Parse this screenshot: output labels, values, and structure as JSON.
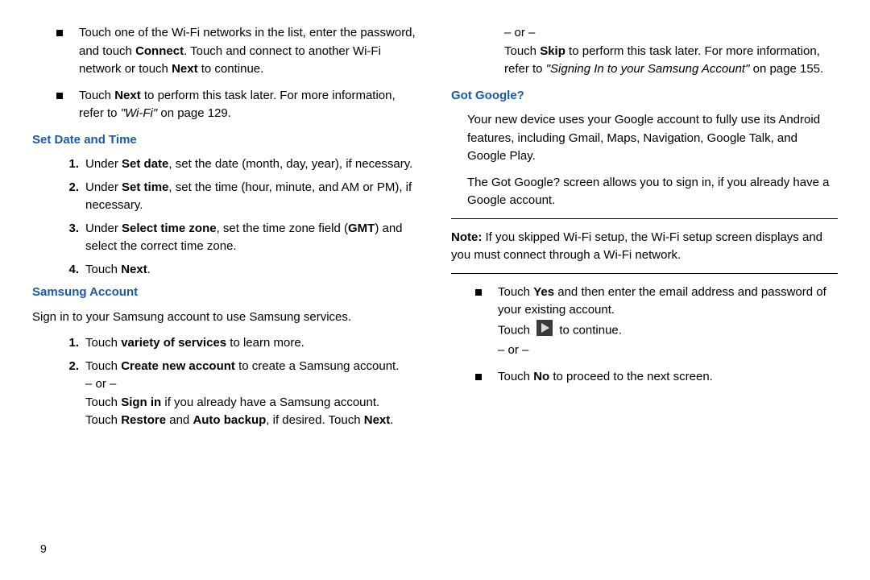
{
  "page_number": "9",
  "left": {
    "bullet1": {
      "pre": "Touch one of the Wi-Fi networks in the list, enter the password, and touch ",
      "connect": "Connect",
      "mid": ". Touch and connect to another Wi-Fi network or touch ",
      "next": "Next",
      "post": " to continue."
    },
    "bullet2": {
      "pre": "Touch ",
      "next": "Next",
      "mid": " to perform this task later. For more information, refer to ",
      "ref": "\"Wi-Fi\"",
      "post": " on page 129."
    },
    "h1": "Set Date and Time",
    "step1": {
      "num": "1.",
      "pre": "Under ",
      "b": "Set date",
      "post": ", set the date (month, day, year), if necessary."
    },
    "step2": {
      "num": "2.",
      "pre": "Under ",
      "b": "Set time",
      "post": ", set the time (hour, minute, and AM or PM), if necessary."
    },
    "step3": {
      "num": "3.",
      "pre": "Under ",
      "b": "Select time zone",
      "mid": ", set the time zone field (",
      "b2": "GMT",
      "post": ") and select the correct time zone."
    },
    "step4": {
      "num": "4.",
      "pre": "Touch ",
      "b": "Next",
      "post": "."
    },
    "h2": "Samsung Account",
    "p2": "Sign in to your Samsung account to use Samsung services.",
    "sa1": {
      "num": "1.",
      "pre": "Touch ",
      "b": "variety of services",
      "post": " to learn more."
    },
    "sa2": {
      "num": "2.",
      "pre": "Touch ",
      "b": "Create new account",
      "post": " to create a Samsung account."
    },
    "or": "– or –",
    "sa2b": {
      "pre": "Touch ",
      "b": "Sign in",
      "post": " if you already have a Samsung account."
    },
    "sa2c": {
      "pre": "Touch ",
      "b1": "Restore",
      "mid": " and ",
      "b2": "Auto backup",
      "post": ", if desired. Touch ",
      "b3": "Next",
      "end": "."
    }
  },
  "right": {
    "or_top": "– or –",
    "b1": {
      "pre": "Touch ",
      "b": "Skip",
      "mid": " to perform this task later. For more information, refer to ",
      "ref": "\"Signing In to your Samsung Account\"",
      "post": " on page 155."
    },
    "h1": "Got Google?",
    "p1": "Your new device uses your Google account to fully use its Android features, including Gmail, Maps, Navigation, Google Talk, and Google Play.",
    "p2": "The Got Google? screen allows you to sign in, if you already have a Google account.",
    "note_label": "Note:",
    "note_text": "If you skipped Wi-Fi setup, the Wi-Fi setup screen displays and you must connect through a Wi-Fi network.",
    "gb1": {
      "pre": "Touch ",
      "b": "Yes",
      "post": " and then enter the email address and password of your existing account."
    },
    "gb1b_pre": "Touch ",
    "gb1b_post": " to continue.",
    "or": "– or –",
    "gb2": {
      "pre": "Touch ",
      "b": "No",
      "post": " to proceed to the next screen."
    }
  }
}
